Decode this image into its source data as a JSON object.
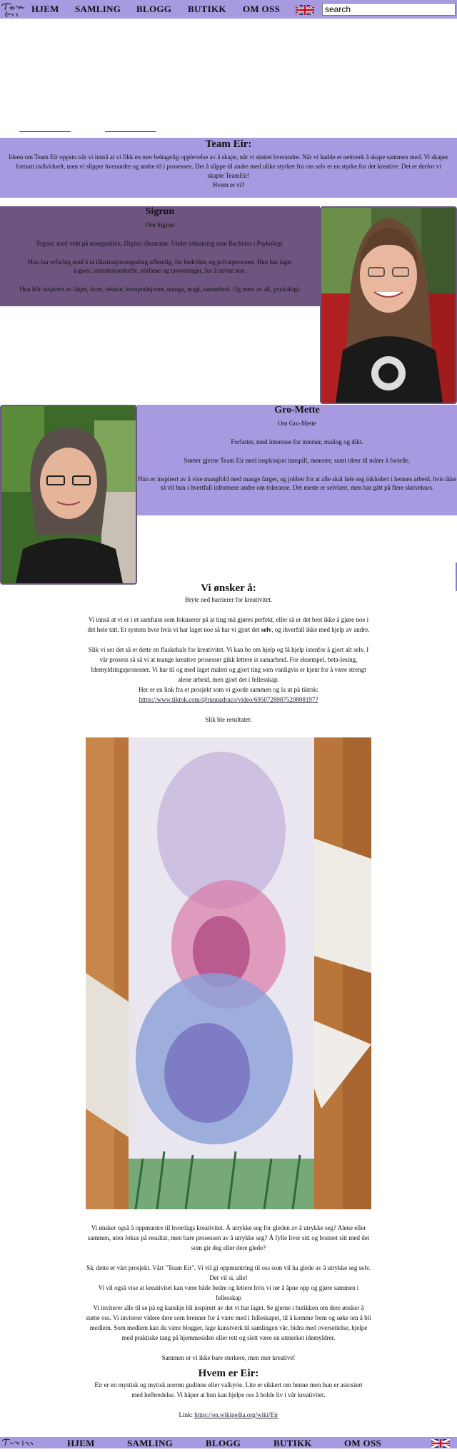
{
  "nav": {
    "logo_text": "Team Eir",
    "items": [
      "HJEM",
      "SAMLING",
      "BLOGG",
      "BUTIKK",
      "OM OSS"
    ],
    "search_value": "search"
  },
  "team": {
    "title": "Team Eir:",
    "body": "Ideen om Team Eir oppsto når vi innså at vi fikk en mer behagelig opplevelse av å skape, når vi støttet hverandre. Når vi hadde et nettverk å skape sammen med. Vi skaper fortsatt individuelt, men vi slipper hverandre og andre til i prosessen. Det å slippe til andre med ulike styrker fra oss selv er en styrke for det kreative. Det er derfor vi skapte TeamEir!",
    "question": "Hvem er vi?"
  },
  "sigrun": {
    "name": "Sigrun",
    "about": "Om Sigrun",
    "p1": "Tegner, med vekt på mangastilen, Digital illustratør. Under utdanning som Bachelor i Psykologi.",
    "p2": "Hun har erfaring med å ta illustrasjonsoppdrag offentlig, for bedrifter, og privatpersoner. Hun har laget logoer, instruksjonshefte, reklame og tatoveringer, for å nevne noe.",
    "p3": "Hun blir inspirert av linjer, form, tekstur, komposisjoner, manga, magi, samarbeid. Og mest av alt, psykologi."
  },
  "gro": {
    "name": "Gro-Mette",
    "about": "Om Gro-Mette",
    "p1": "Forfatter, med interesse for interiør, maling og dikt.",
    "p2": "Støtter gjerne Team Eir med inspirasjon innspill, mønster, samt ideer til måter å fortelle.",
    "p3": "Hun er inspirert av å vise mangfold med mange farger, og jobber for at alle skal føle seg inkludert i hennes arbeid, hvis ikke så vil hun i hvertfall informere andre om toleranse. Det meste er selvlært, men har gått på flere skrivekurs."
  },
  "wish": {
    "title": "Vi ønsker å:",
    "subtitle": "Bryte ned barrierer for kreativitet.",
    "p1_a": "Vi innså at vi er i et samfunn som fokuserer på at ting må gjøres perfekt, eller så er det best ikke å gjøre noe i det hele tatt. Et system hvor hvis vi har laget noe så har vi gjort det ",
    "p1_bold": "selv",
    "p1_b": ", og ihverfall ikke med hjelp av andre.",
    "p2": "Slik vi ser det så er dette en flaskehals for kreativitet. Vi kan be om hjelp og få hjelp istenfor å gjort alt selv. I vår prosess så så vi at mange kreative prosesser gikk lettere is samarbeid. For eksempel, beta-lesing, Idemyldringsprosesser. Vi har til og med laget maleri og gjort ting som vanligvis er kjent for å være strengt alene arbeid, men gjort det i fellesskap.",
    "p3": "Her er en link fra et prosjekt som vi gjorde sammen og la ut på tiktok:",
    "link": "https://www.tiktok.com/@runnadraco/video/6950728087520808197?",
    "result": "Slik ble resultatet:"
  },
  "outro": {
    "p1": "Vi ønsker også å oppmuntre til hverdags kreativitet. Å utrykke seg for gleden av å utrykke seg? Alene eller sammen, uten fokus på resultat, men bare prosessen av å utrykke seg? Å fylle liver sitt og bosteet sitt med det som gir deg eller dere glede?",
    "p2": "Så, dette er vårt prosjekt. Vårt \"Team Eir\". Vi vil gi oppmuntring til oss som vil ha glede av å utrykke seg selv. Det vil si, alle!",
    "p3": "Vi vil også vise at kreativitet kan være både bedre og lettere hvis vi tør å åpne opp og gjøre sammen i fellesskap",
    "p4": "Vi inviterer alle til se på og kanskje bli inspirert av det vi har laget. Se gjerne i butikken om dere ønsker å støtte oss. Vi inviterer videre dere som brenner for å være med i felleskapet, til å komme frem og søke om å bli medlem. Som medlem kan du være blogger, lage kunstverk til samlingen vår, bidra med oversettelse, hjelpe med praktiske tang på hjemmesiden eller rett og slett være en utmerket idemyldrer.",
    "p5": "Sammen er vi ikke bare sterkere, men mer kreative!",
    "eir_title": "Hvem er Eir:",
    "eir_body": "Eir er en mystisk og mytisk norrøn gudinne eller valkyrie. Lite er sikkert om henne men hun er assosiert med helbredelse. Vi håper at hun kan hjelpe oss å holde liv i vår kreativitet.",
    "link_label": "Link: ",
    "link": "https://en.wikipedia.org/wiki/Eir"
  },
  "colors": {
    "accent": "#a79ae0",
    "dark_accent": "#6e5580"
  }
}
